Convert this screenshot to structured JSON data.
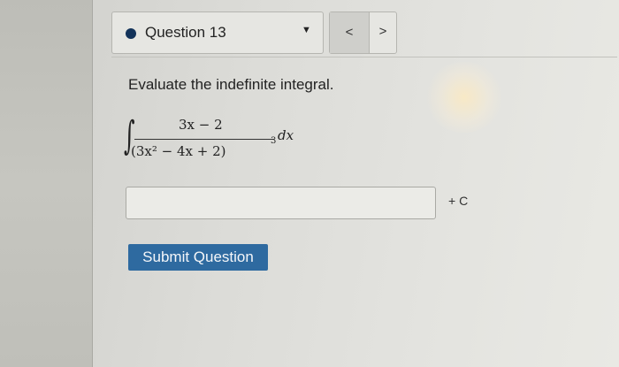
{
  "question_nav": {
    "selected_question": "Question 13",
    "dropdown_icon": "caret-down-icon",
    "prev_icon": "chevron-left-icon",
    "next_icon": "chevron-right-icon",
    "prev_label": "<",
    "next_label": ">",
    "status_dot_color": "#13335a"
  },
  "problem": {
    "prompt": "Evaluate the indefinite integral.",
    "integral_sign": "∫",
    "numerator": "3x − 2",
    "denominator": "(3x² − 4x + 2)",
    "denominator_exponent": "3",
    "differential": "dx"
  },
  "answer": {
    "value": "",
    "placeholder": "",
    "suffix": "+ C"
  },
  "submit": {
    "label": "Submit Question",
    "color": "#2e6aa0"
  }
}
